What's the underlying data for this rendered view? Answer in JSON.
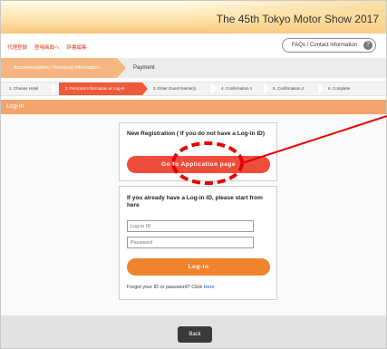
{
  "header": {
    "banner_title": "The 45th Tokyo Motor Show 2017",
    "sub_links": [
      "代理登録",
      "登場画面へ",
      "辞書編集"
    ],
    "faq_label": "FAQs / Contact information",
    "faq_icon": "question-icon"
  },
  "tabs": {
    "active_label": "Accommodation / Personal Information",
    "next_label": "Payment"
  },
  "steps": [
    "1. Choose Hotel",
    "2. Personal Information or Log-in",
    "3. Enter Guest Name(s)",
    "4. Confirmation 1",
    "5. Confirmation 2",
    "6. Complete"
  ],
  "section": {
    "title": "Log-in"
  },
  "registration": {
    "title": "New Registration ( If you do not have a Log-in ID)",
    "button_label": "Go to Application page"
  },
  "login": {
    "title": "If you already have a Log-in ID, please start from here",
    "id_placeholder": "Log-in ID",
    "password_placeholder": "Password",
    "button_label": "Log-in",
    "forgot_text": "Forgot your ID or password? Click",
    "forgot_link": "Here"
  },
  "footer": {
    "back_label": "Back"
  },
  "colors": {
    "accent_red": "#ee4d3b",
    "accent_orange": "#f0832e",
    "section_orange": "#f4a36a",
    "annotation_red": "#e60000"
  }
}
